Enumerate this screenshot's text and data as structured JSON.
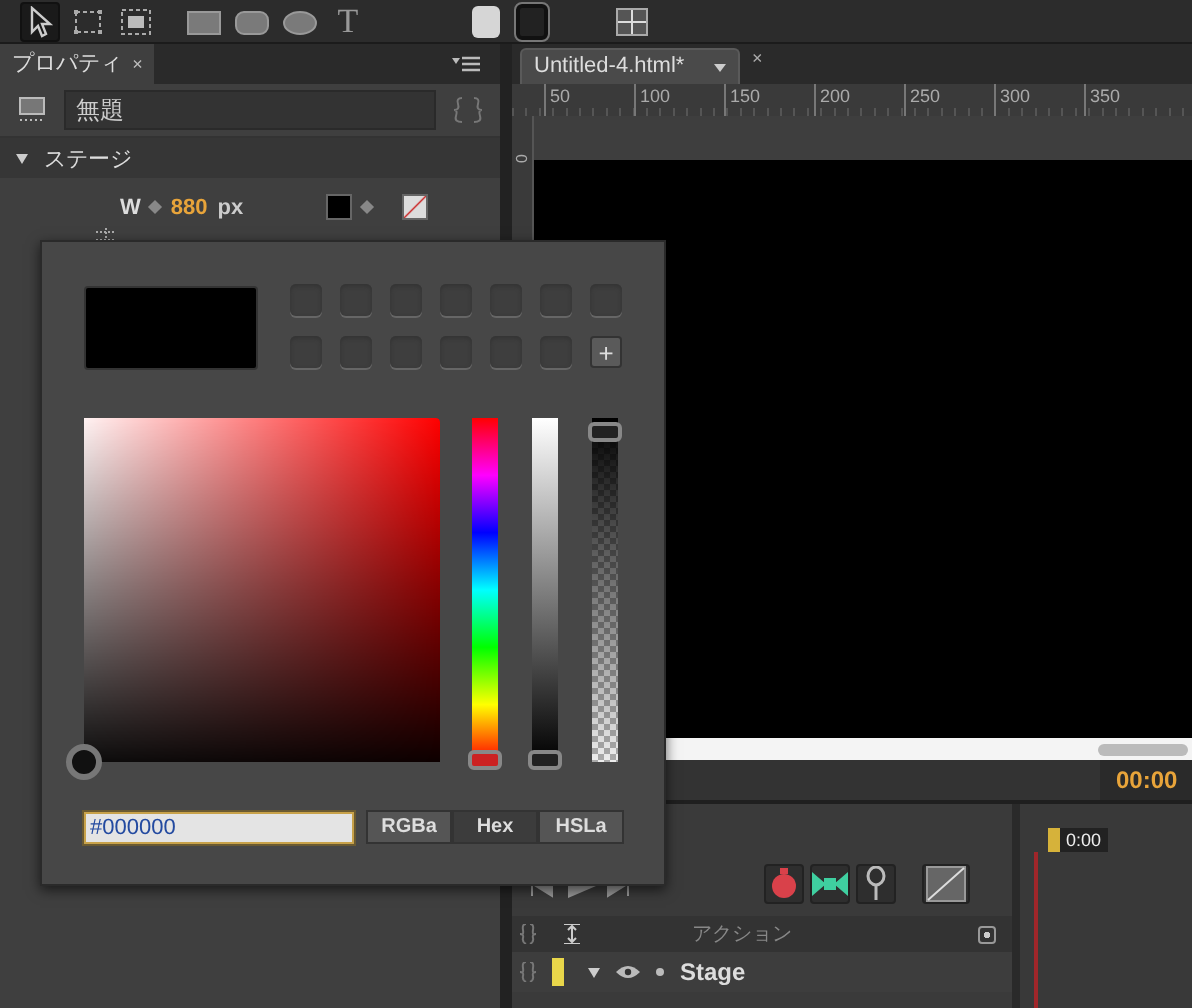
{
  "toolbar": {
    "tools": [
      {
        "kind": "arrow",
        "selected": true
      },
      {
        "kind": "transform",
        "selected": false
      },
      {
        "kind": "clip",
        "selected": false
      },
      {
        "kind": "rect",
        "selected": false
      },
      {
        "kind": "rounded-rect",
        "selected": false
      },
      {
        "kind": "ellipse",
        "selected": false
      },
      {
        "kind": "text",
        "label": "T",
        "selected": false
      }
    ]
  },
  "properties_panel": {
    "tab": {
      "label": "プロパティ",
      "close": "×"
    },
    "element_name": "無題",
    "section": {
      "title": "ステージ",
      "expanded": true
    },
    "width_row": {
      "label": "W",
      "value": "880",
      "unit": "px"
    }
  },
  "document": {
    "tab": {
      "label": "Untitled-4.html*",
      "close": "×"
    },
    "ruler_labels": [
      "50",
      "100",
      "150",
      "200",
      "250",
      "300",
      "350"
    ],
    "vertical_ruler_label": "0",
    "timecode": "00:00"
  },
  "timeline": {
    "playhead": "0:00",
    "header": "アクション",
    "rows": [
      {
        "label": "Stage",
        "expanded": true,
        "color": "#e8d64a"
      }
    ]
  },
  "color_picker": {
    "add_swatch": "+",
    "hue": {
      "level": 0
    },
    "brightness": {
      "level": 0
    },
    "alpha": {
      "level": 1
    },
    "hex_value": "#000000",
    "modes": [
      {
        "label": "RGBa",
        "selected": false
      },
      {
        "label": "Hex",
        "selected": true
      },
      {
        "label": "HSLa",
        "selected": false
      }
    ]
  }
}
